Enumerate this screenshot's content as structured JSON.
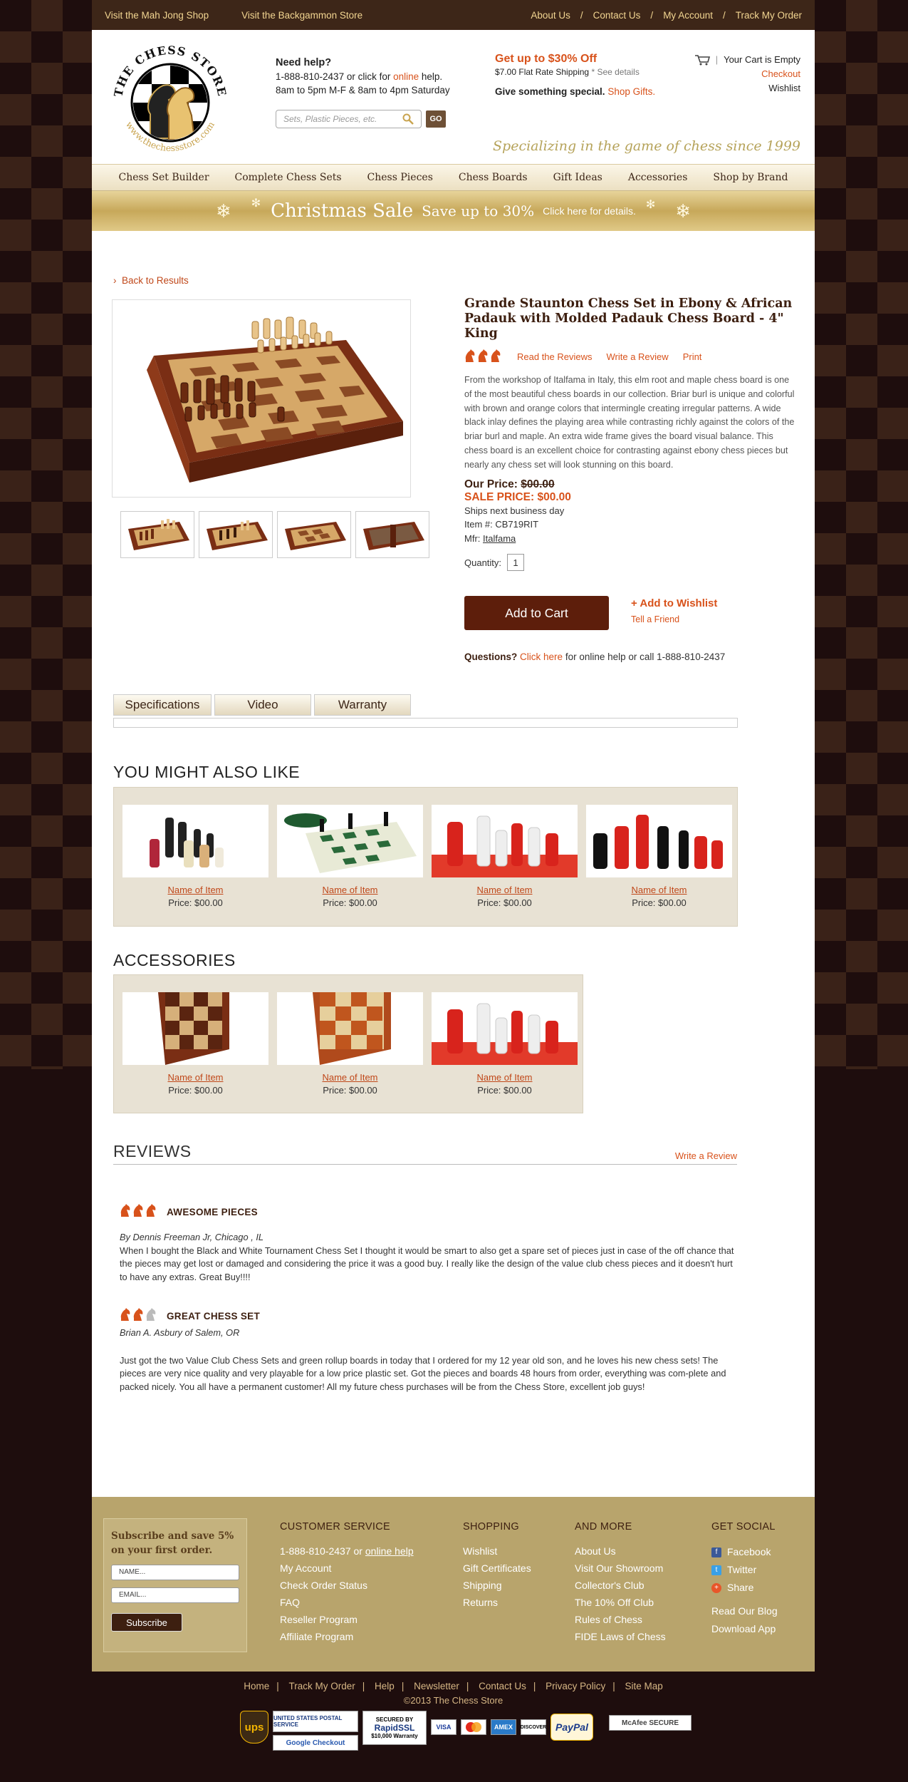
{
  "topbar": {
    "mahjong": "Visit the Mah Jong Shop",
    "backgammon": "Visit the Backgammon Store",
    "about": "About Us",
    "contact": "Contact Us",
    "account": "My Account",
    "track": "Track My Order",
    "sep": "/"
  },
  "logo": {
    "top": "THE CHESS STORE",
    "bottom": "www.thechessstore.com"
  },
  "help": {
    "title": "Need help?",
    "phone": "1-888-810-2437 or click for",
    "online": "online",
    "help_word": "help.",
    "hours": "8am to 5pm M-F & 8am to 4pm Saturday"
  },
  "search": {
    "placeholder": "Sets, Plastic Pieces, etc.",
    "go": "GO"
  },
  "promo": {
    "headline": "Get up to $30% Off",
    "shipping": "$7.00 Flat Rate Shipping",
    "see": "* See details",
    "gift": "Give something special.",
    "gift_link": "Shop Gifts."
  },
  "cart": {
    "status": "Your Cart is Empty",
    "checkout": "Checkout",
    "wishlist": "Wishlist"
  },
  "tagline": "Specializing in the game of chess since 1999",
  "nav": [
    "Chess Set Builder",
    "Complete Chess Sets",
    "Chess Pieces",
    "Chess Boards",
    "Gift Ideas",
    "Accessories",
    "Shop by Brand"
  ],
  "banner": {
    "title": "Christmas Sale",
    "sub": "Save up to 30%",
    "cta": "Click here for details."
  },
  "back": "Back to Results",
  "product": {
    "title": "Grande Staunton Chess Set in Ebony & African Padauk with Molded Padauk Chess Board - 4\" King",
    "reviews_link": "Read the Reviews",
    "write_link": "Write a Review",
    "print": "Print",
    "description": "From the workshop of Italfama in Italy, this elm root and maple chess board is one of the most beautiful chess boards in our collection. Briar burl is unique and colorful with brown and orange colors that intermingle creating irregular patterns. A wide black inlay defines the playing area while contrasting richly against the colors of the briar burl and maple. An extra wide frame gives the board visual balance. This chess board is an excellent choice for contrasting against ebony chess pieces but nearly any chess set will look stunning on this board.",
    "our_price_label": "Our Price:",
    "our_price": "$00.00",
    "sale_label": "SALE PRICE:",
    "sale_price": "$00.00",
    "ships": "Ships next business day",
    "item": "Item #: CB719RIT",
    "mfr_label": "Mfr:",
    "mfr": "Italfama",
    "qty_label": "Quantity:",
    "qty": "1",
    "add": "Add to Cart",
    "wishlist": "+ Add to Wishlist",
    "tell": "Tell a Friend",
    "q_label": "Questions?",
    "q_link": "Click here",
    "q_rest": "for online help or call 1-888-810-2437",
    "rating": 3
  },
  "tabs": [
    "Specifications",
    "Video",
    "Warranty"
  ],
  "also": {
    "title": "YOU MIGHT ALSO LIKE",
    "items": [
      {
        "name": "Name of Item",
        "price": "Price: $00.00"
      },
      {
        "name": "Name of Item",
        "price": "Price: $00.00"
      },
      {
        "name": "Name of Item",
        "price": "Price: $00.00"
      },
      {
        "name": "Name of Item",
        "price": "Price: $00.00"
      }
    ]
  },
  "accessories": {
    "title": "ACCESSORIES",
    "items": [
      {
        "name": "Name of Item",
        "price": "Price: $00.00"
      },
      {
        "name": "Name of Item",
        "price": "Price: $00.00"
      },
      {
        "name": "Name of Item",
        "price": "Price: $00.00"
      }
    ]
  },
  "reviews": {
    "title": "REVIEWS",
    "write": "Write a Review",
    "list": [
      {
        "rating": 3,
        "title": "AWESOME PIECES",
        "by": "By Dennis Freeman Jr, Chicago , IL",
        "text": "When I bought the Black and White Tournament Chess Set I thought it would be smart to also get a spare set of pieces just in case of the off chance that the pieces may get lost or damaged and considering the price it was a good buy. I really like the design of the value club chess pieces and it doesn't hurt to have any extras. Great Buy!!!!"
      },
      {
        "rating": 2,
        "title": "GREAT CHESS SET",
        "by": "Brian A. Asbury of Salem, OR",
        "text": "Just got the two Value Club Chess Sets and green rollup boards in today that I ordered for my 12 year old son, and he loves his new chess sets! The pieces are very nice quality and very playable for a low price plastic set. Got the pieces and boards 48 hours from order, everything was com-plete and packed nicely. You all have a permanent customer! All my future chess purchases will be from the Chess Store, excellent job guys!"
      }
    ]
  },
  "footer": {
    "subscribe": "Subscribe and save 5% on your first order.",
    "name_ph": "NAME...",
    "email_ph": "EMAIL...",
    "subscribe_btn": "Subscribe",
    "cs": {
      "title": "CUSTOMER SERVICE",
      "phone": "1-888-810-2437 or",
      "online": "online help",
      "items": [
        "My Account",
        "Check Order Status",
        "FAQ",
        "Reseller Program",
        "Affiliate Program"
      ]
    },
    "shop": {
      "title": "SHOPPING",
      "items": [
        "Wishlist",
        "Gift Certificates",
        "Shipping",
        "Returns"
      ]
    },
    "more": {
      "title": "AND MORE",
      "items": [
        "About Us",
        "Visit Our Showroom",
        "Collector's Club",
        "The 10% Off Club",
        "Rules of Chess",
        "FIDE Laws of Chess"
      ]
    },
    "social": {
      "title": "GET SOCIAL",
      "facebook": "Facebook",
      "twitter": "Twitter",
      "share": "Share",
      "blog": "Read Our Blog",
      "app": "Download App"
    },
    "links": [
      "Home",
      "Track My Order",
      "Help",
      "Newsletter",
      "Contact Us",
      "Privacy Policy",
      "Site Map"
    ],
    "copyright": "©2013 The Chess Store",
    "badges": {
      "ups": "ups",
      "usps": "UNITED STATES POSTAL SERVICE",
      "ssl_top": "SECURED BY",
      "ssl": "RapidSSL",
      "ssl_bottom": "$10,000 Warranty",
      "visa": "VISA",
      "amex": "AMEX",
      "discover": "DISCOVER",
      "paypal": "PayPal",
      "mcafee": "McAfee SECURE",
      "gcheckout": "Google Checkout"
    }
  },
  "colors": {
    "accent": "#d8521b",
    "brown": "#3d2618",
    "gold": "#b8a46c"
  }
}
